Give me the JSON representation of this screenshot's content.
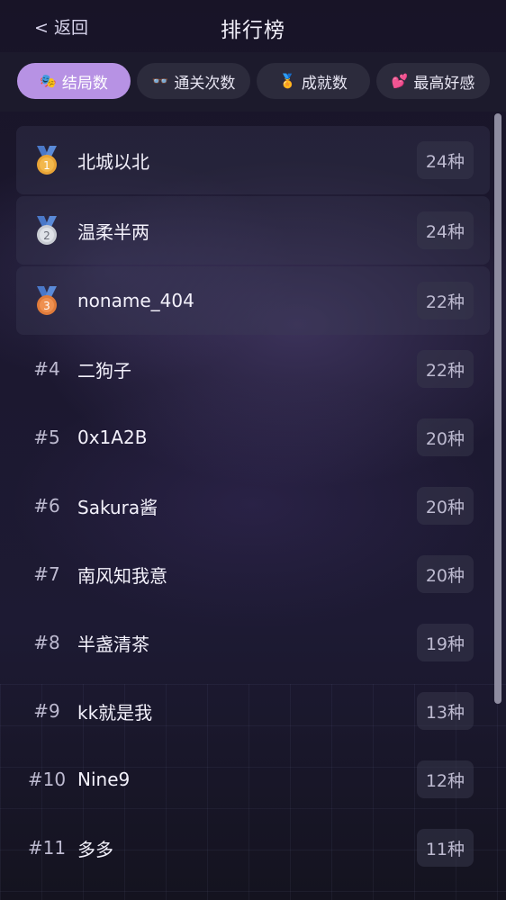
{
  "header": {
    "back_label": "< 返回",
    "title": "排行榜"
  },
  "tabs": [
    {
      "label": "结局数",
      "icon": "masks-icon",
      "active": true
    },
    {
      "label": "通关次数",
      "icon": "glasses-icon",
      "active": false
    },
    {
      "label": "成就数",
      "icon": "medal-icon",
      "active": false
    },
    {
      "label": "最高好感",
      "icon": "hearts-icon",
      "active": false
    }
  ],
  "rows": [
    {
      "rank": "",
      "medal": "gold-medal-icon",
      "name": "北城以北",
      "count": "24种"
    },
    {
      "rank": "",
      "medal": "silver-medal-icon",
      "name": "温柔半两",
      "count": "24种"
    },
    {
      "rank": "",
      "medal": "bronze-medal-icon",
      "name": "noname_404",
      "count": "22种"
    },
    {
      "rank": "#4",
      "name": "二狗子",
      "count": "22种"
    },
    {
      "rank": "#5",
      "name": "0x1A2B",
      "count": "20种"
    },
    {
      "rank": "#6",
      "name": "Sakura酱",
      "count": "20种"
    },
    {
      "rank": "#7",
      "name": "南风知我意",
      "count": "20种"
    },
    {
      "rank": "#8",
      "name": "半盏清茶",
      "count": "19种"
    },
    {
      "rank": "#9",
      "name": "kk就是我",
      "count": "13种"
    },
    {
      "rank": "#10",
      "name": "Nine9",
      "count": "12种"
    },
    {
      "rank": "#11",
      "name": "多多",
      "count": "11种"
    }
  ],
  "colors": {
    "accent": "#b792e4",
    "gold": "#e9a436",
    "silver": "#c9ccd3",
    "bronze": "#e07b3a",
    "ribbon": "#4a78c8"
  }
}
